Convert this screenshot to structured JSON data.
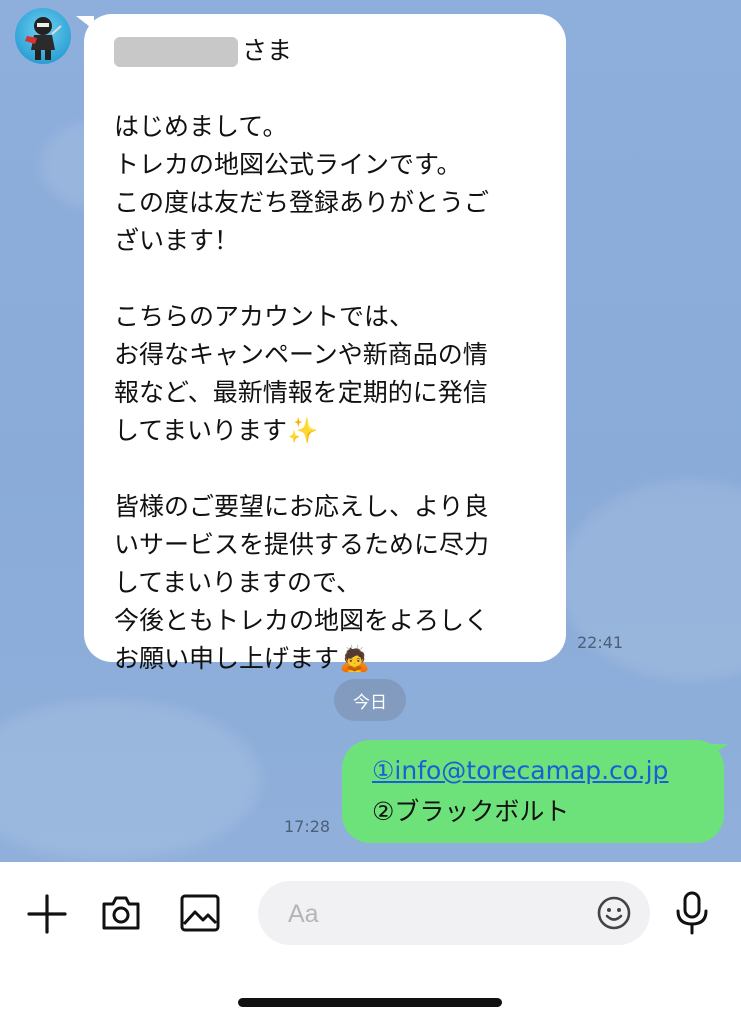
{
  "incoming": {
    "name_suffix": "さま",
    "body": "はじめまして。\nトレカの地図公式ラインです。\nこの度は友だち登録ありがとうご\nざいます！\n\nこちらのアカウントでは、\nお得なキャンペーンや新商品の情\n報など、最新情報を定期的に発信\nしてまいります✨\n\n皆様のご要望にお応えし、より良\nいサービスを提供するために尽力\nしてまいりますので、\n今後ともトレカの地図をよろしく\nお願い申し上げます🙇",
    "time": "22:41"
  },
  "date_divider": "今日",
  "outgoing": {
    "line1": "①info@torecamap.co.jp",
    "line2": "②ブラックボルト",
    "time": "17:28"
  },
  "input": {
    "placeholder": "Aa"
  },
  "icons": {
    "add": "plus-icon",
    "camera": "camera-icon",
    "image": "image-icon",
    "emoji": "emoji-icon",
    "mic": "microphone-icon"
  },
  "colors": {
    "chat_background": "#8eaedc",
    "outgoing_bubble": "#6de17a",
    "incoming_bubble": "#ffffff",
    "link": "#1a5fd6"
  }
}
